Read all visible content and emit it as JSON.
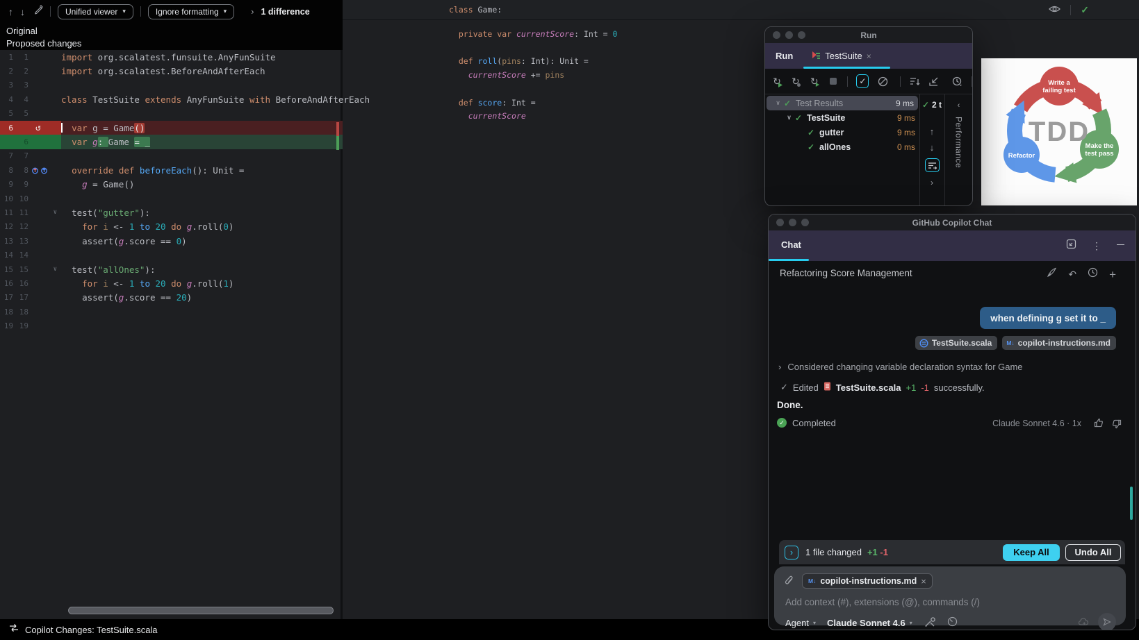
{
  "diff": {
    "toolbar": {
      "viewer_mode": "Unified viewer",
      "formatting_mode": "Ignore formatting",
      "diff_count": "1 difference"
    },
    "labels": {
      "original": "Original",
      "proposed": "Proposed changes"
    },
    "rows": [
      {
        "n1": "1",
        "n2": "1",
        "code": [
          [
            "kw",
            "import"
          ],
          [
            "pl",
            " org.scalatest.funsuite.AnyFunSuite"
          ]
        ]
      },
      {
        "n1": "2",
        "n2": "2",
        "code": [
          [
            "kw",
            "import"
          ],
          [
            "pl",
            " org.scalatest.BeforeAndAfterEach"
          ]
        ]
      },
      {
        "n1": "3",
        "n2": "3",
        "code": []
      },
      {
        "n1": "4",
        "n2": "4",
        "code": [
          [
            "kw",
            "class"
          ],
          [
            "pl",
            " TestSuite "
          ],
          [
            "kw",
            "extends"
          ],
          [
            "pl",
            " AnyFunSuite "
          ],
          [
            "kw",
            "with"
          ],
          [
            "pl",
            " BeforeAndAfterEach"
          ]
        ]
      },
      {
        "n1": "5",
        "n2": "5",
        "code": []
      },
      {
        "type": "del",
        "n1": "6",
        "n2": "",
        "gutter": "revert",
        "cursor": true,
        "code": [
          [
            "pl",
            "  "
          ],
          [
            "kw",
            "var"
          ],
          [
            "pl",
            " g = Game"
          ],
          [
            "chipd",
            "()"
          ]
        ]
      },
      {
        "type": "add",
        "n1": "",
        "n2": "6",
        "code": [
          [
            "pl",
            "  "
          ],
          [
            "kw",
            "var"
          ],
          [
            "pl",
            " "
          ],
          [
            "fld",
            "g"
          ],
          [
            "chipa",
            ": "
          ],
          [
            "pl",
            "Game "
          ],
          [
            "chipa",
            "= _"
          ]
        ]
      },
      {
        "n1": "7",
        "n2": "7",
        "code": []
      },
      {
        "n1": "8",
        "n2": "8",
        "gutter": "override",
        "code": [
          [
            "pl",
            "  "
          ],
          [
            "kw",
            "override"
          ],
          [
            "pl",
            " "
          ],
          [
            "kw",
            "def"
          ],
          [
            "pl",
            " "
          ],
          [
            "fn",
            "beforeEach"
          ],
          [
            "pl",
            "(): Unit ="
          ]
        ]
      },
      {
        "n1": "9",
        "n2": "9",
        "code": [
          [
            "pl",
            "    "
          ],
          [
            "fld",
            "g"
          ],
          [
            "pl",
            " = Game()"
          ]
        ]
      },
      {
        "n1": "10",
        "n2": "10",
        "code": []
      },
      {
        "n1": "11",
        "n2": "11",
        "gutter": "fold",
        "code": [
          [
            "pl",
            "  test("
          ],
          [
            "str",
            "\"gutter\""
          ],
          [
            "pl",
            "):"
          ]
        ]
      },
      {
        "n1": "12",
        "n2": "12",
        "code": [
          [
            "pl",
            "    "
          ],
          [
            "kw",
            "for"
          ],
          [
            "pl",
            " "
          ],
          [
            "prm",
            "i"
          ],
          [
            "pl",
            " <- "
          ],
          [
            "num",
            "1"
          ],
          [
            "pl",
            " "
          ],
          [
            "fn",
            "to"
          ],
          [
            "pl",
            " "
          ],
          [
            "num",
            "20"
          ],
          [
            "pl",
            " "
          ],
          [
            "kw",
            "do"
          ],
          [
            "pl",
            " "
          ],
          [
            "fld",
            "g"
          ],
          [
            "pl",
            ".roll("
          ],
          [
            "num",
            "0"
          ],
          [
            "pl",
            ")"
          ]
        ]
      },
      {
        "n1": "13",
        "n2": "13",
        "code": [
          [
            "pl",
            "    assert("
          ],
          [
            "fld",
            "g"
          ],
          [
            "pl",
            ".score == "
          ],
          [
            "num",
            "0"
          ],
          [
            "pl",
            ")"
          ]
        ]
      },
      {
        "n1": "14",
        "n2": "14",
        "code": []
      },
      {
        "n1": "15",
        "n2": "15",
        "gutter": "fold",
        "code": [
          [
            "pl",
            "  test("
          ],
          [
            "str",
            "\"allOnes\""
          ],
          [
            "pl",
            "):"
          ]
        ]
      },
      {
        "n1": "16",
        "n2": "16",
        "code": [
          [
            "pl",
            "    "
          ],
          [
            "kw",
            "for"
          ],
          [
            "pl",
            " "
          ],
          [
            "prm",
            "i"
          ],
          [
            "pl",
            " <- "
          ],
          [
            "num",
            "1"
          ],
          [
            "pl",
            " "
          ],
          [
            "fn",
            "to"
          ],
          [
            "pl",
            " "
          ],
          [
            "num",
            "20"
          ],
          [
            "pl",
            " "
          ],
          [
            "kw",
            "do"
          ],
          [
            "pl",
            " "
          ],
          [
            "fld",
            "g"
          ],
          [
            "pl",
            ".roll("
          ],
          [
            "num",
            "1"
          ],
          [
            "pl",
            ")"
          ]
        ]
      },
      {
        "n1": "17",
        "n2": "17",
        "code": [
          [
            "pl",
            "    assert("
          ],
          [
            "fld",
            "g"
          ],
          [
            "pl",
            ".score == "
          ],
          [
            "num",
            "20"
          ],
          [
            "pl",
            ")"
          ]
        ]
      },
      {
        "n1": "18",
        "n2": "18",
        "code": []
      },
      {
        "n1": "19",
        "n2": "19",
        "code": []
      }
    ]
  },
  "editor": {
    "sticky_line": [
      [
        "kw",
        "class"
      ],
      [
        "pl",
        " Game:"
      ]
    ],
    "lines": [
      [
        [
          "pl",
          "  "
        ],
        [
          "kw",
          "private"
        ],
        [
          "pl",
          " "
        ],
        [
          "kw",
          "var"
        ],
        [
          "pl",
          " "
        ],
        [
          "fld",
          "currentScore"
        ],
        [
          "pl",
          ": Int = "
        ],
        [
          "num",
          "0"
        ]
      ],
      [],
      [
        [
          "pl",
          "  "
        ],
        [
          "kw",
          "def"
        ],
        [
          "pl",
          " "
        ],
        [
          "fn",
          "roll"
        ],
        [
          "pl",
          "("
        ],
        [
          "prm",
          "pins"
        ],
        [
          "pl",
          ": Int): Unit ="
        ]
      ],
      [
        [
          "pl",
          "    "
        ],
        [
          "fld",
          "currentScore"
        ],
        [
          "pl",
          " += "
        ],
        [
          "prm",
          "pins"
        ]
      ],
      [],
      [
        [
          "pl",
          "  "
        ],
        [
          "kw",
          "def"
        ],
        [
          "pl",
          " "
        ],
        [
          "fn",
          "score"
        ],
        [
          "pl",
          ": Int ="
        ]
      ],
      [
        [
          "pl",
          "    "
        ],
        [
          "fld",
          "currentScore"
        ]
      ]
    ]
  },
  "run": {
    "window_title": "Run",
    "tab_bar_label": "Run",
    "tab_name": "TestSuite",
    "counter": "2 t",
    "side_tab": "Performance",
    "tree": [
      {
        "label": "Test Results",
        "time": "9 ms",
        "level": 0,
        "chevron": true,
        "selected": true,
        "muted": true
      },
      {
        "label": "TestSuite",
        "time": "9 ms",
        "level": 1,
        "chevron": true
      },
      {
        "label": "gutter",
        "time": "9 ms",
        "level": 2
      },
      {
        "label": "allOnes",
        "time": "0 ms",
        "level": 2
      }
    ]
  },
  "tdd": {
    "center": "TDD",
    "step1_l1": "Write a",
    "step1_l2": "failing test",
    "step2_l1": "Make the",
    "step2_l2": "test pass",
    "step3": "Refactor",
    "colors": {
      "red": "#c9504e",
      "green": "#68a46b",
      "blue": "#5e97e8"
    }
  },
  "chat": {
    "window_title": "GitHub Copilot Chat",
    "tab_name": "Chat",
    "thread_title": "Refactoring Score Management",
    "user_message": "when defining g set it to _",
    "context_chips": [
      "TestSuite.scala",
      "copilot-instructions.md"
    ],
    "thought": "Considered changing variable declaration syntax for Game",
    "edited": {
      "prefix": "Edited",
      "file": "TestSuite.scala",
      "added": "+1",
      "removed": "-1",
      "suffix": "successfully."
    },
    "done": "Done.",
    "completed": "Completed",
    "model_info": "Claude Sonnet 4.6 · 1x",
    "changes": {
      "summary": "1 file changed",
      "added": "+1",
      "removed": "-1",
      "keep_label": "Keep All",
      "undo_label": "Undo All"
    },
    "input": {
      "chip": "copilot-instructions.md",
      "placeholder": "Add context (#), extensions (@), commands (/)",
      "mode": "Agent",
      "model": "Claude Sonnet 4.6"
    }
  },
  "status_bar": {
    "text": "Copilot Changes: TestSuite.scala"
  },
  "accent_colors": {
    "cyan": "#27ccee",
    "test_green": "#4d9e58",
    "time_orange": "#cf9152",
    "bubble_blue": "#2d5c88"
  }
}
